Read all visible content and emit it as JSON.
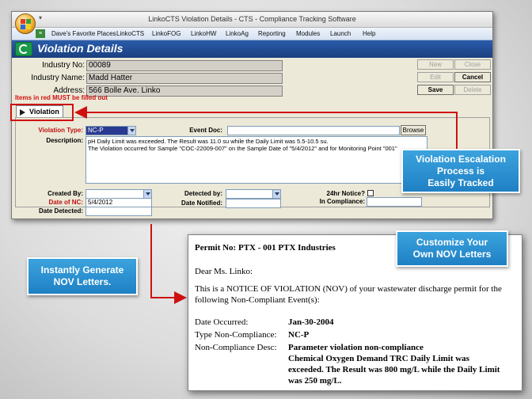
{
  "window": {
    "title": "LinkoCTS Violation Details  -  CTS - Compliance Tracking Software",
    "menu": [
      "Dave's Favorite Places",
      "LinkoCTS",
      "LinkoFOG",
      "LinkoHW",
      "LinkoAg",
      "Reporting",
      "Modules",
      "Launch",
      "Help"
    ],
    "header_title": "Violation Details"
  },
  "industry": {
    "no_label": "Industry No:",
    "no_value": "00089",
    "name_label": "Industry Name:",
    "name_value": "Madd Hatter",
    "address_label": "Address:",
    "address_value": "566 Bolle Ave. Linko"
  },
  "buttons": {
    "new": "New",
    "close": "Close",
    "edit": "Edit",
    "cancel": "Cancel",
    "save": "Save",
    "delete": "Delete"
  },
  "required_note": "Items in red MUST be filled out",
  "tab_label": "Violation",
  "form": {
    "violation_type_label": "Violation Type:",
    "violation_type_value": "NC-P",
    "event_doc_label": "Event Doc:",
    "event_doc_value": "",
    "browse_label": "Browse",
    "description_label": "Description:",
    "description_lines": [
      "pH Daily Limit was exceeded.  The Result was 11.0 su while the Daily Limit was 5.5-10.5 su.",
      "The Violation occurred for Sample \"COC-22009-007\" on the Sample Date of \"5/4/2012\" and for Monitoring Point \"001\""
    ],
    "created_by_label": "Created By:",
    "created_by_value": "",
    "date_nc_label": "Date of NC:",
    "date_nc_value": "5/4/2012",
    "date_detected_label": "Date Detected:",
    "date_detected_value": "",
    "detected_by_label": "Detected by:",
    "detected_by_value": "",
    "date_notified_label": "Date Notified:",
    "date_notified_value": "",
    "notice_24hr_label": "24hr Notice?",
    "in_compliance_label": "In Compliance:",
    "in_compliance_value": ""
  },
  "callouts": {
    "escalation": [
      "Violation Escalation",
      "Process is",
      "Easily Tracked"
    ],
    "generate": [
      "Instantly Generate",
      "NOV Letters."
    ],
    "customize": [
      "Customize Your",
      "Own NOV Letters"
    ]
  },
  "letter": {
    "permit": "Permit No: PTX - 001 PTX Industries",
    "salutation": "Dear Ms. Linko:",
    "body_line1": "This is a NOTICE OF VIOLATION (NOV) of your wastewater discharge  permit for the",
    "body_line2": "following Non-Compliant Event(s):",
    "date_label": "Date Occurred:",
    "date_value": "Jan-30-2004",
    "type_label": "Type Non-Compliance:",
    "type_value": "NC-P",
    "desc_label": "Non-Compliance Desc:",
    "desc_lines": [
      "Parameter violation non-compliance",
      "Chemical Oxygen Demand TRC Daily Limit was",
      "exceeded.  The Result was 800 mg/L while the Daily Limit",
      "was 250 mg/L."
    ]
  },
  "colors": {
    "header_blue": "#1b3f80",
    "callout_blue": "#1f80c4",
    "arrow_red": "#d01010"
  }
}
